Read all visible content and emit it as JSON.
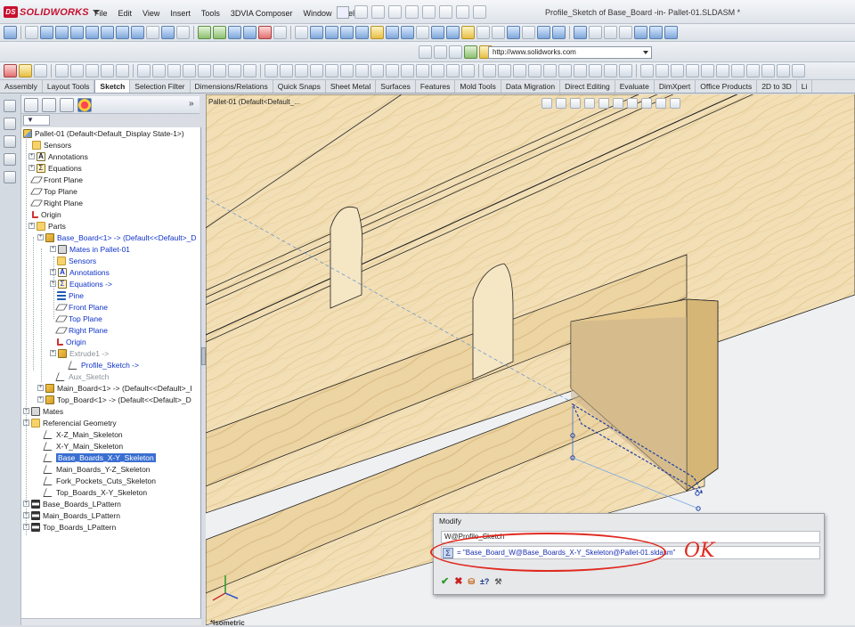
{
  "app": {
    "name": "SOLIDWORKS",
    "document_title": "Profile_Sketch of Base_Board -in- Pallet-01.SLDASM *"
  },
  "menu": [
    "File",
    "Edit",
    "View",
    "Insert",
    "Tools",
    "3DVIA Composer",
    "Window",
    "Help"
  ],
  "url_bar": {
    "value": "http://www.solidworks.com"
  },
  "tabs": [
    "Assembly",
    "Layout Tools",
    "Sketch",
    "Selection Filter",
    "Dimensions/Relations",
    "Quick Snaps",
    "Sheet Metal",
    "Surfaces",
    "Features",
    "Mold Tools",
    "Data Migration",
    "Direct Editing",
    "Evaluate",
    "DimXpert",
    "Office Products",
    "2D to 3D",
    "Li"
  ],
  "active_tab": "Sketch",
  "feature_manager": {
    "filter_label": "▼",
    "expand_label": "»",
    "items": [
      {
        "label": "Pallet-01  (Default<Default_Display State-1>)",
        "icon": "assembly-icon"
      },
      {
        "label": "Sensors",
        "icon": "sensors-folder-icon"
      },
      {
        "label": "Annotations",
        "icon": "annotations-icon"
      },
      {
        "label": "Equations",
        "icon": "equations-icon"
      },
      {
        "label": "Front Plane",
        "icon": "plane-icon"
      },
      {
        "label": "Top Plane",
        "icon": "plane-icon"
      },
      {
        "label": "Right Plane",
        "icon": "plane-icon"
      },
      {
        "label": "Origin",
        "icon": "origin-icon"
      },
      {
        "label": "Parts",
        "icon": "parts-folder-icon"
      },
      {
        "label": "Base_Board<1> -> (Default<<Default>_D",
        "icon": "part-icon"
      },
      {
        "label": "Mates in Pallet-01",
        "icon": "mates-icon"
      },
      {
        "label": "Sensors",
        "icon": "sensors-folder-icon"
      },
      {
        "label": "Annotations",
        "icon": "annotations-icon"
      },
      {
        "label": "Equations ->",
        "icon": "equations-icon"
      },
      {
        "label": "Pine",
        "icon": "material-icon"
      },
      {
        "label": "Front Plane",
        "icon": "plane-icon"
      },
      {
        "label": "Top Plane",
        "icon": "plane-icon"
      },
      {
        "label": "Right Plane",
        "icon": "plane-icon"
      },
      {
        "label": "Origin",
        "icon": "origin-icon"
      },
      {
        "label": "Extrude1 ->",
        "icon": "extrude-icon"
      },
      {
        "label": "Profile_Sketch ->",
        "icon": "sketch-icon"
      },
      {
        "label": "Aux_Sketch",
        "icon": "sketch-icon"
      },
      {
        "label": "Main_Board<1> -> (Default<<Default>_I",
        "icon": "part-icon"
      },
      {
        "label": "Top_Board<1> -> (Default<<Default>_D",
        "icon": "part-icon"
      },
      {
        "label": "Mates",
        "icon": "mates-icon"
      },
      {
        "label": "Referencial Geometry",
        "icon": "folder-icon"
      },
      {
        "label": "X-Z_Main_Skeleton",
        "icon": "sketch-icon"
      },
      {
        "label": "X-Y_Main_Skeleton",
        "icon": "sketch-icon"
      },
      {
        "label": "Base_Boards_X-Y_Skeleton",
        "icon": "sketch-icon"
      },
      {
        "label": "Main_Boards_Y-Z_Skeleton",
        "icon": "sketch-icon"
      },
      {
        "label": "Fork_Pockets_Cuts_Skeleton",
        "icon": "sketch-icon"
      },
      {
        "label": "Top_Boards_X-Y_Skeleton",
        "icon": "sketch-icon"
      },
      {
        "label": "Base_Boards_LPattern",
        "icon": "pattern-icon"
      },
      {
        "label": "Main_Boards_LPattern",
        "icon": "pattern-icon"
      },
      {
        "label": "Top_Boards_LPattern",
        "icon": "pattern-icon"
      }
    ]
  },
  "viewport": {
    "breadcrumb": "Pallet-01  (Default<Default_...",
    "view_label": "*Isometric"
  },
  "modify_dialog": {
    "title": "Modify",
    "dimension_name": "W@Profile_Sketch",
    "equation_value": "= \"Base_Board_W@Base_Boards_X-Y_Skeleton@Pallet-01.sldasm\"",
    "sigma_label": "Σ",
    "buttons": {
      "ok": "✔",
      "cancel": "✖",
      "rebuild": "⛁",
      "spin": "±?",
      "mark": "⚒"
    }
  },
  "annotation": {
    "handwritten_note": "OK",
    "highlight_color": "#e02a20"
  },
  "colors": {
    "wood": "#f3e1b8",
    "selection": "#3a6fd1",
    "link_blue": "#0f33c8"
  }
}
